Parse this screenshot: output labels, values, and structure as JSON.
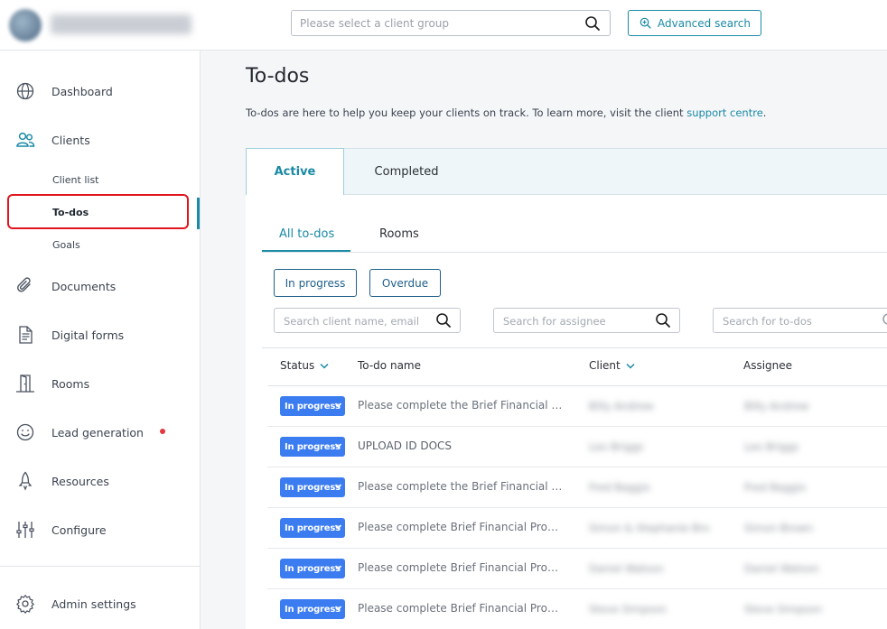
{
  "topbar": {
    "client_search_placeholder": "Please select a client group",
    "advanced_search_label": "Advanced search"
  },
  "sidebar": {
    "items": [
      {
        "label": "Dashboard",
        "icon": "globe-icon"
      },
      {
        "label": "Clients",
        "icon": "users-icon"
      },
      {
        "label": "Documents",
        "icon": "paperclip-icon"
      },
      {
        "label": "Digital forms",
        "icon": "document-icon"
      },
      {
        "label": "Rooms",
        "icon": "door-icon"
      },
      {
        "label": "Lead generation",
        "icon": "smiley-icon"
      },
      {
        "label": "Resources",
        "icon": "rocket-icon"
      },
      {
        "label": "Configure",
        "icon": "sliders-icon"
      }
    ],
    "subitems": [
      {
        "label": "Client list"
      },
      {
        "label": "To-dos"
      },
      {
        "label": "Goals"
      }
    ],
    "admin_label": "Admin settings"
  },
  "page": {
    "title": "To-dos",
    "description": "To-dos are here to help you keep your clients on track. To learn more, visit the client ",
    "link": "support centre",
    "description_end": "."
  },
  "tabs": {
    "active": "Active",
    "completed": "Completed"
  },
  "subtabs": {
    "all": "All to-dos",
    "rooms": "Rooms"
  },
  "filters": {
    "in_progress": "In progress",
    "overdue": "Overdue"
  },
  "searches": {
    "client": "Search client name, email",
    "assignee": "Search for assignee",
    "todos": "Search for to-dos"
  },
  "table": {
    "headers": {
      "status": "Status",
      "name": "To-do name",
      "client": "Client",
      "assignee": "Assignee"
    },
    "rows": [
      {
        "status": "In progress",
        "name": "Please complete the Brief Financial Pr...",
        "client": "Billy Andrew",
        "assignee": "Billy Andrew"
      },
      {
        "status": "In progress",
        "name": "UPLOAD ID DOCS",
        "client": "Leo Briggs",
        "assignee": "Leo Briggs"
      },
      {
        "status": "In progress",
        "name": "Please complete the Brief Financial Pr...",
        "client": "Fred Baggio",
        "assignee": "Fred Baggio"
      },
      {
        "status": "In progress",
        "name": "Please complete Brief Financial Profile",
        "client": "Simon & Stephanie Bro",
        "assignee": "Simon Brown"
      },
      {
        "status": "In progress",
        "name": "Please complete Brief Financial Profile",
        "client": "Daniel Watson",
        "assignee": "Daniel Watson"
      },
      {
        "status": "In progress",
        "name": "Please complete Brief Financial Profile",
        "client": "Steve Simpson",
        "assignee": "Steve Simpson"
      }
    ]
  },
  "colors": {
    "accent": "#1a8aa5",
    "badge": "#3b7cf0",
    "highlight": "#e0161f"
  }
}
